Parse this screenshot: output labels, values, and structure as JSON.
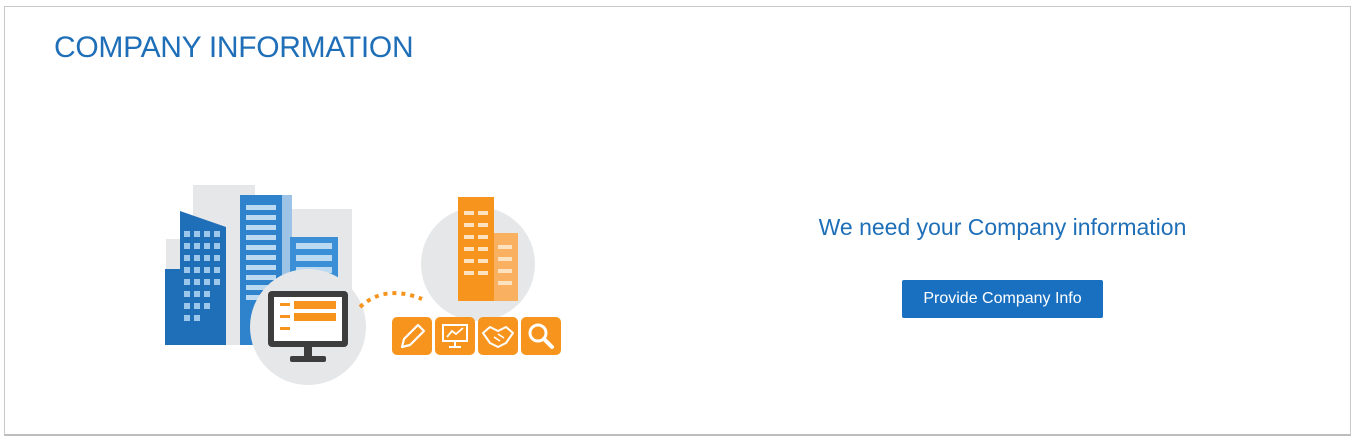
{
  "header": {
    "title": "COMPANY INFORMATION"
  },
  "main": {
    "message": "We need your Company information",
    "button_label": "Provide Company Info"
  },
  "illustration": {
    "icons": [
      "buildings-icon",
      "monitor-form-icon",
      "office-building-icon",
      "pencil-icon",
      "presentation-icon",
      "handshake-icon",
      "search-icon"
    ]
  },
  "colors": {
    "accent": "#1f6fb8",
    "button": "#1a70c0",
    "orange": "#f7941d",
    "gray": "#e6e7e8",
    "dark": "#3d3d3d"
  }
}
